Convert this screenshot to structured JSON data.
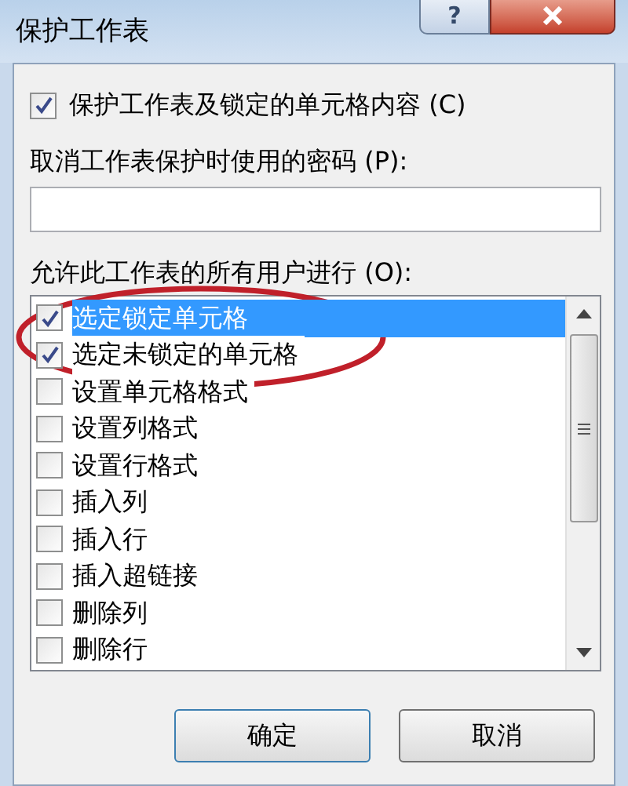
{
  "window": {
    "title": "保护工作表",
    "help": "?"
  },
  "protect": {
    "label": "保护工作表及锁定的单元格内容 (C)",
    "checked": true
  },
  "password": {
    "label": "取消工作表保护时使用的密码 (P):"
  },
  "permissions": {
    "label": "允许此工作表的所有用户进行 (O):",
    "items": [
      {
        "label": "选定锁定单元格",
        "checked": true,
        "selected": true
      },
      {
        "label": "选定未锁定的单元格",
        "checked": true,
        "selected": false
      },
      {
        "label": "设置单元格格式",
        "checked": false,
        "selected": false
      },
      {
        "label": "设置列格式",
        "checked": false,
        "selected": false
      },
      {
        "label": "设置行格式",
        "checked": false,
        "selected": false
      },
      {
        "label": "插入列",
        "checked": false,
        "selected": false
      },
      {
        "label": "插入行",
        "checked": false,
        "selected": false
      },
      {
        "label": "插入超链接",
        "checked": false,
        "selected": false
      },
      {
        "label": "删除列",
        "checked": false,
        "selected": false
      },
      {
        "label": "删除行",
        "checked": false,
        "selected": false
      }
    ]
  },
  "buttons": [
    {
      "label": "确定"
    },
    {
      "label": "取消"
    }
  ]
}
